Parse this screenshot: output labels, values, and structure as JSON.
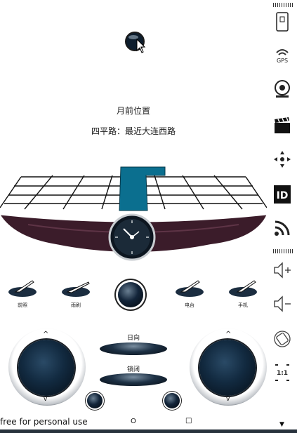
{
  "status": {
    "location_title": "月前位置",
    "location_text": "四平路：最近大连西路"
  },
  "gauge": {
    "instrument": "heading-gauge"
  },
  "car_controls": [
    {
      "label": "前照",
      "icon": "headlight-icon"
    },
    {
      "label": "雨刷",
      "icon": "wiper-icon"
    },
    {
      "label": "电台",
      "icon": "radio-icon"
    },
    {
      "label": "手机",
      "icon": "phone-icon"
    }
  ],
  "center_buttons": {
    "forward_label": "日向",
    "lock_label": "锁闭"
  },
  "footer": {
    "watermark": "free for personal use",
    "circle_glyph": "O",
    "square_glyph": "□"
  },
  "sidebar": {
    "items": [
      {
        "name": "phone-device-icon"
      },
      {
        "name": "gps-icon",
        "label": "GPS"
      },
      {
        "name": "camera-icon"
      },
      {
        "name": "clapper-icon"
      },
      {
        "name": "dpad-icon"
      },
      {
        "name": "id-icon",
        "label": "ID"
      },
      {
        "name": "rss-icon"
      },
      {
        "name": "volume-up-icon"
      },
      {
        "name": "volume-down-icon"
      },
      {
        "name": "rotate-icon"
      },
      {
        "name": "aspect-icon",
        "label": "1:1"
      }
    ]
  },
  "colors": {
    "accent_blue": "#0b6f8f",
    "dark_navy": "#0a1a2b",
    "maroon": "#3b1c2a"
  }
}
